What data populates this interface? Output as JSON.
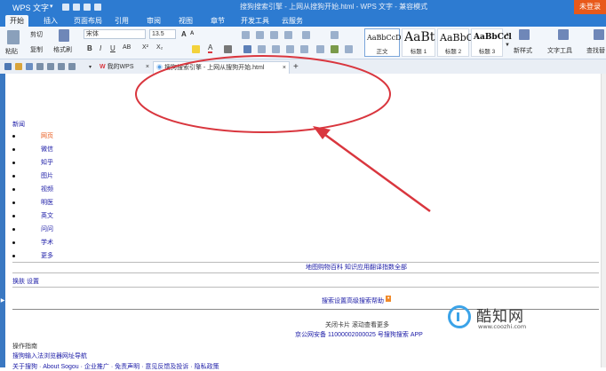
{
  "titlebar": {
    "app_label": "WPS 文字",
    "window_title": "搜狗搜索引擎 - 上网从搜狗开始.html - WPS 文字 - 兼容模式",
    "login_button": "未登录"
  },
  "menu": [
    "开始",
    "插入",
    "页面布局",
    "引用",
    "审阅",
    "视图",
    "章节",
    "开发工具",
    "云服务"
  ],
  "ribbon": {
    "paste": "粘贴",
    "cut": "剪切",
    "copy": "复制",
    "format_painter": "格式刷",
    "font_name": "宋体",
    "font_size": "13.5",
    "styles": [
      {
        "sample": "AaBbCcDd",
        "name": "正文"
      },
      {
        "sample": "AaBt",
        "name": "标题 1"
      },
      {
        "sample": "AaBbC",
        "name": "标题 2"
      },
      {
        "sample": "AaBbCcl",
        "name": "标题 3"
      }
    ],
    "new_style": "新样式",
    "text_tools": "文字工具",
    "find_replace": "查找替"
  },
  "tabs": {
    "my_wps": "我的WPS",
    "document": "搜狗搜索引擎 - 上网从搜狗开始.html"
  },
  "document": {
    "section_label": "新闻",
    "nav_items": [
      "网页",
      "微信",
      "知乎",
      "图片",
      "视频",
      "明医",
      "英文",
      "问问",
      "学术",
      "更多"
    ],
    "links_row": "地图购物百科 知识应用翻译指数全部",
    "skin_settings": "换肤 设置",
    "search_help": "搜索设置高级搜索帮助",
    "search_help_badge": "•",
    "close_card": "关闭卡片 滚动查看更多",
    "icp": "京公网安备 11000002000025 号搜狗搜索 APP",
    "ops_guide": "操作指南",
    "input_method_link": "搜狗输入法浏览器网址导航",
    "footer_links": "关于搜狗 · About Sogou · 企业推广 · 免责声明 · 意见反馈及投诉 · 隐私政策"
  },
  "watermark": {
    "name": "酷知网",
    "url": "www.coozhi.com"
  },
  "colors": {
    "titlebar": "#2d7bd1",
    "annotation": "#d9363e",
    "link": "#1a1aa6",
    "active_nav": "#e8591a"
  }
}
